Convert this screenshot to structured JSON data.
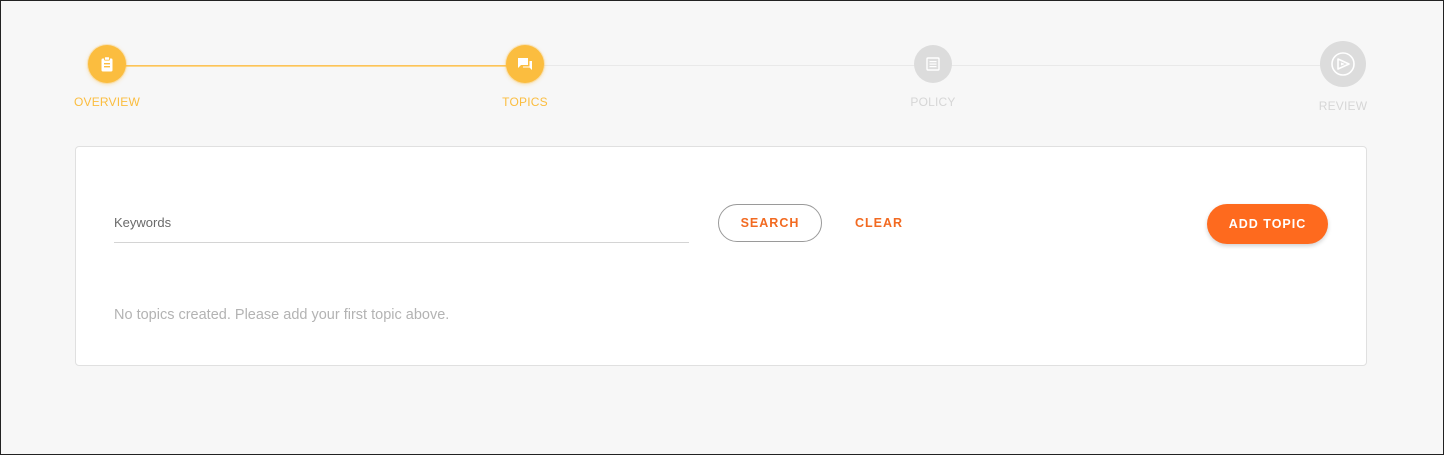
{
  "stepper": {
    "steps": [
      {
        "label": "OVERVIEW",
        "icon": "clipboard-icon",
        "state": "completed"
      },
      {
        "label": "TOPICS",
        "icon": "chat-icon",
        "state": "active"
      },
      {
        "label": "POLICY",
        "icon": "document-list-icon",
        "state": "pending"
      },
      {
        "label": "REVIEW",
        "icon": "review-icon",
        "state": "pending"
      }
    ]
  },
  "search": {
    "placeholder": "Keywords",
    "value": "",
    "search_label": "SEARCH",
    "clear_label": "CLEAR",
    "add_label": "ADD TOPIC"
  },
  "empty_state": {
    "message": "No topics created. Please add your first topic above."
  },
  "colors": {
    "accent": "#fbbd3f",
    "primary": "#fe6a1e",
    "inactive": "#dcdcdc"
  }
}
